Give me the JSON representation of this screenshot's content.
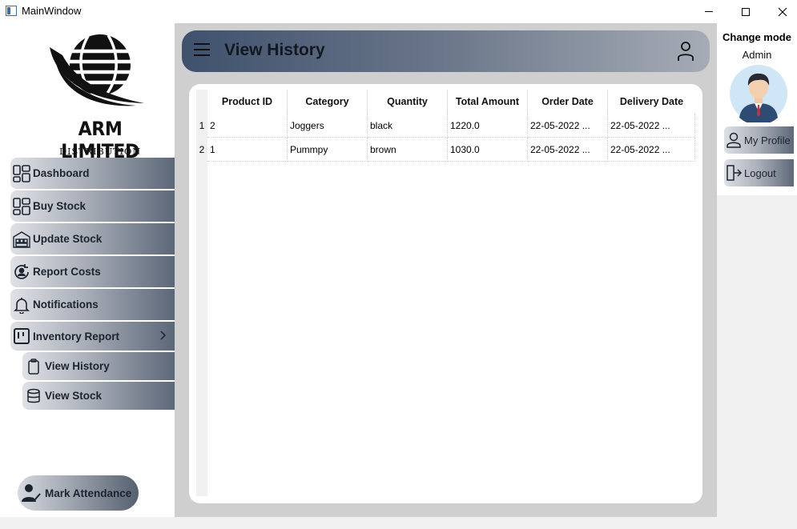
{
  "window": {
    "title": "MainWindow"
  },
  "logo": {
    "name": "ARM LIMITED",
    "subtitle": "DISTRIBUTION COMPANY"
  },
  "sidebar": {
    "items": [
      {
        "label": "Dashboard",
        "icon": "dashboard-icon"
      },
      {
        "label": "Buy Stock",
        "icon": "grid-icon"
      },
      {
        "label": "Update Stock",
        "icon": "warehouse-icon"
      },
      {
        "label": "Report Costs",
        "icon": "refresh-user-icon"
      },
      {
        "label": "Notifications",
        "icon": "bell-icon"
      },
      {
        "label": "Inventory Report",
        "icon": "kanban-icon"
      }
    ],
    "subitems": [
      {
        "label": "View History",
        "icon": "clipboard-icon"
      },
      {
        "label": "View Stock",
        "icon": "database-icon"
      }
    ],
    "attendance_label": "Mark Attendance"
  },
  "header": {
    "title": "View History"
  },
  "table": {
    "columns": [
      "Product ID",
      "Category",
      "Quantity",
      "Total Amount",
      "Order Date",
      "Delivery Date"
    ],
    "rows": [
      {
        "num": "1",
        "cells": [
          "2",
          "Joggers",
          "black",
          "1220.0",
          "22-05-2022 ...",
          "22-05-2022 ..."
        ]
      },
      {
        "num": "2",
        "cells": [
          "1",
          "Pummpy",
          "brown",
          "1030.0",
          "22-05-2022 ...",
          "22-05-2022 ..."
        ]
      }
    ]
  },
  "right_panel": {
    "change_mode_label": "Change mode",
    "role": "Admin",
    "my_profile_label": "My Profile",
    "logout_label": "Logout"
  },
  "colors": {
    "header_dark": "#3f516d",
    "header_light": "#a6acb6",
    "button_dark": "#5c6778"
  }
}
